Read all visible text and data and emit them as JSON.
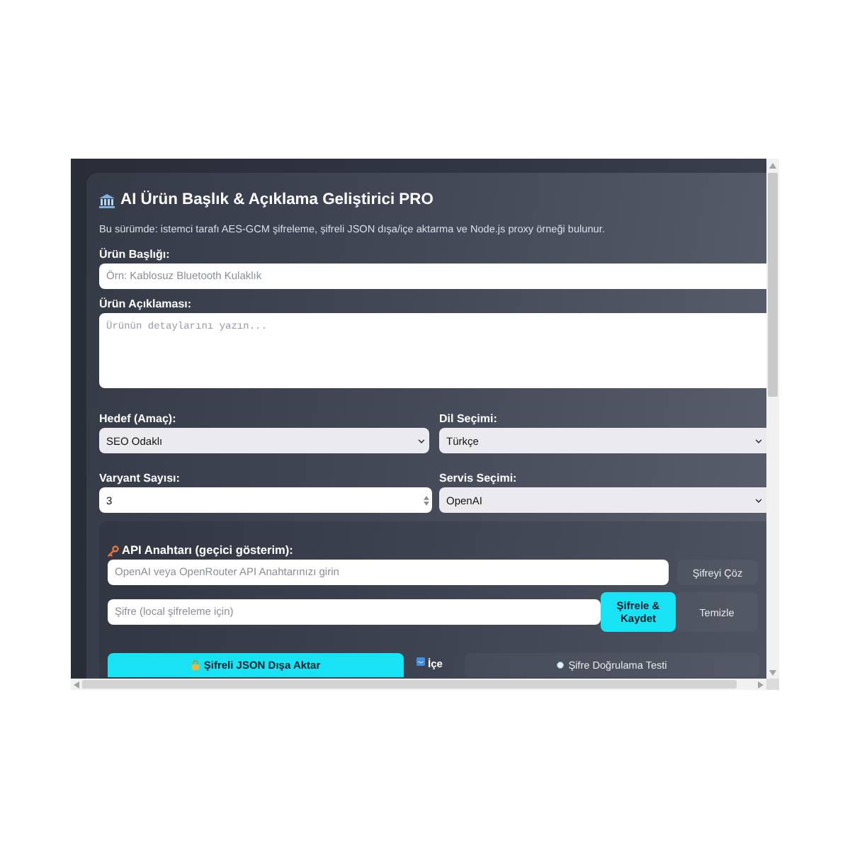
{
  "header": {
    "title": "AI Ürün Başlık & Açıklama Geliştirici PRO",
    "subtitle": "Bu sürümde: istemci tarafı AES-GCM şifreleme, şifreli JSON dışa/içe aktarma ve Node.js proxy örneği bulunur."
  },
  "fields": [
    {
      "kind": "text",
      "label": "Ürün Başlığı:",
      "placeholder": "Örn: Kablosuz Bluetooth Kulaklık"
    },
    {
      "kind": "textarea",
      "label": "Ürün Açıklaması:",
      "placeholder": "Ürünün detaylarını yazın..."
    }
  ],
  "settings": [
    {
      "kind": "select",
      "label": "Hedef (Amaç):",
      "value": "SEO Odaklı"
    },
    {
      "kind": "select",
      "label": "Dil Seçimi:",
      "value": "Türkçe"
    },
    {
      "kind": "number",
      "label": "Varyant Sayısı:",
      "value": "3"
    },
    {
      "kind": "select",
      "label": "Servis Seçimi:",
      "value": "OpenAI"
    }
  ],
  "api_key": {
    "title": "API Anahtarı (geçici gösterim):",
    "key_field": {
      "placeholder": "OpenAI veya OpenRouter API Anahtarınızı girin"
    },
    "decrypt_button": "Şifreyi Çöz",
    "password_field": {
      "placeholder": "Şifre (local şifreleme için)"
    },
    "encrypt_button": "Şifrele & Kaydet",
    "clear_button": "Temizle"
  },
  "actions": [
    {
      "kind": "primary",
      "label": "Şifreli JSON Dışa Aktar"
    },
    {
      "kind": "compact",
      "label": "İçe"
    },
    {
      "kind": "plain",
      "label": "Şifre Doğrulama Testi"
    }
  ]
}
